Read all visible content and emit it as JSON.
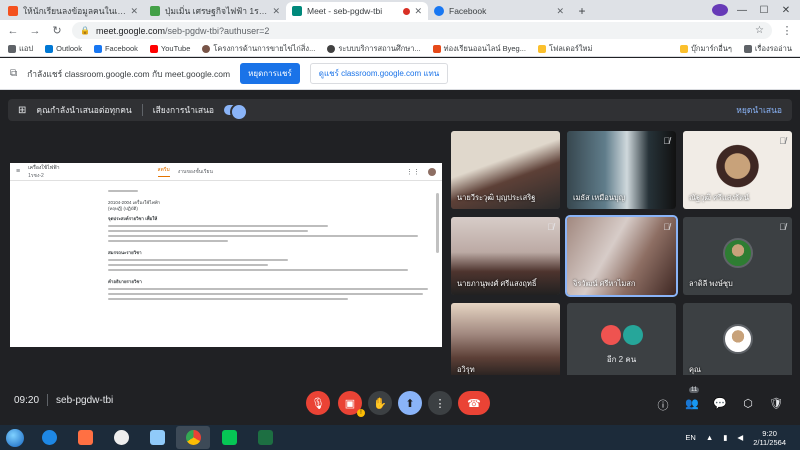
{
  "browser": {
    "tabs": [
      {
        "title": "ให้นักเรียนลงข้อมูลคนในเขตเลม",
        "favicon_color": "#f4511e",
        "active": false
      },
      {
        "title": "ปุ่มเมิ่น เศรษฐกิจไฟฟ้า 1รชง1",
        "favicon_color": "#43a047",
        "active": false
      },
      {
        "title": "Meet - seb-pgdw-tbi",
        "favicon_color": "#00897b",
        "active": true
      },
      {
        "title": "Facebook",
        "favicon_color": "#1877f2",
        "active": false
      }
    ],
    "new_tab_symbol": "+",
    "url_host": "meet.google.com",
    "url_path": "/seb-pgdw-tbi?authuser=2",
    "bookmarks": [
      {
        "label": "แอป",
        "color": "#5f6368"
      },
      {
        "label": "Outlook",
        "color": "#0078d4"
      },
      {
        "label": "Facebook",
        "color": "#1877f2"
      },
      {
        "label": "YouTube",
        "color": "#ff0000"
      },
      {
        "label": "โครงการด้านการขายไข่ไก่สิ่ง...",
        "color": "#795548"
      },
      {
        "label": "ระบบบริการสถานศึกษา...",
        "color": "#424242"
      },
      {
        "label": "ท่องเรียนออนไลน์ Byeg...",
        "color": "#e64a19"
      },
      {
        "label": "โฟลเดอร์ใหม่",
        "color": "#fbc02d"
      }
    ],
    "bookmarks_right": [
      {
        "label": "บุ๊กมาร์กอื่นๆ",
        "color": "#fbc02d"
      },
      {
        "label": "เรื่องรออ่าน",
        "color": "#5f6368"
      }
    ]
  },
  "infobar": {
    "message": "กำลังแชร์ classroom.google.com กับ meet.google.com",
    "stop_label": "หยุดการแชร์",
    "switch_label": "ดูแชร์ classroom.google.com แทน"
  },
  "meet": {
    "present_text": "คุณกำลังนำเสนอต่อทุกคน",
    "audio_label": "เสียงการนำเสนอ",
    "stop_presenting": "หยุดนำเสนอ",
    "time": "09:20",
    "meeting_code": "seb-pgdw-tbi",
    "people_count": "11",
    "participants": [
      {
        "name": "นายวีระวุฒิ บุญประเสริฐ",
        "video_colors": [
          "#d9d2c7",
          "#4e342e"
        ],
        "highlighted": false
      },
      {
        "name": "เมธัส เหมือนบุญ",
        "video_colors": [
          "#cfd8dc",
          "#263238"
        ],
        "highlighted": false
      },
      {
        "name": "ณัฐวุฒิ ศรีแสงรัตน์",
        "video_colors": [
          "#efebe9",
          "#6d4c41"
        ],
        "highlighted": false
      },
      {
        "name": "นายภานุพงศ์ ศรีแสงฤทธิ์",
        "video_colors": [
          "#d7ccc8",
          "#3e2723"
        ],
        "highlighted": false
      },
      {
        "name": "จิรวัฒน์ ศรีหาไมสก",
        "video_colors": [
          "#bcaaa4",
          "#5d4037"
        ],
        "highlighted": true
      },
      {
        "name": "ลาดิลี พงษ์ชุบ",
        "video_colors": [
          "#3c4043",
          "#3c4043"
        ],
        "highlighted": false
      },
      {
        "name": "อวิรุท",
        "video_colors": [
          "#c8b8a8",
          "#4e342e"
        ],
        "highlighted": false
      },
      {
        "name": "อีก 2 คน",
        "video_colors": [
          "#3c4043",
          "#3c4043"
        ],
        "highlighted": false
      },
      {
        "name": "คุณ",
        "video_colors": [
          "#3c4043",
          "#3c4043"
        ],
        "highlighted": false
      }
    ]
  },
  "document": {
    "header_title": "เครื่องใช้ไฟฟ้า",
    "header_sub": "1รชง-2",
    "tab_stream": "สตรีม",
    "tab_classwork": "งานของชั้นเรียน",
    "course_code_line": "20104-2004  เครื่องใช้ไฟฟ้า",
    "credit_line": "(ทฤษฎี) (ปฏิบัติ)",
    "purpose_heading": "จุดประสงค์รายวิชา เพื่อให้",
    "competency_heading": "สมรรถนะรายวิชา",
    "description_heading": "คำอธิบายรายวิชา"
  },
  "taskbar": {
    "apps": [
      {
        "name": "internet-explorer",
        "color": "#1e88e5"
      },
      {
        "name": "media-player",
        "color": "#ff7043"
      },
      {
        "name": "sync-app",
        "color": "#eeeeee"
      },
      {
        "name": "file-app",
        "color": "#90caf9"
      },
      {
        "name": "chrome",
        "color": "#fbbc04"
      },
      {
        "name": "line",
        "color": "#06c755"
      },
      {
        "name": "excel",
        "color": "#1d6f42"
      }
    ],
    "language": "EN",
    "time": "9:20",
    "date": "2/11/2564"
  }
}
